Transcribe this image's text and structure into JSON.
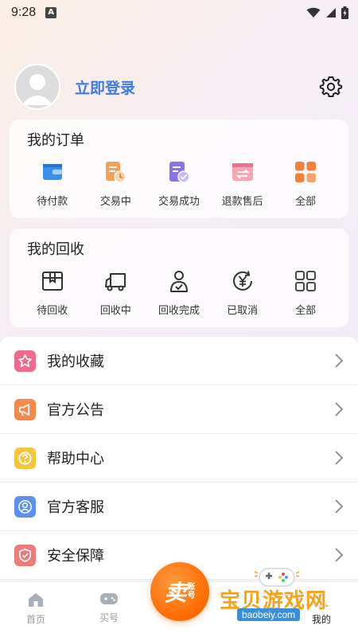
{
  "status_bar": {
    "time": "9:28",
    "notif_letter": "A"
  },
  "profile": {
    "login_label": "立即登录"
  },
  "orders": {
    "title": "我的订单",
    "items": [
      {
        "label": "待付款",
        "icon": "wallet-icon",
        "color": "#3a8fe8"
      },
      {
        "label": "交易中",
        "icon": "trading-clock-icon",
        "color": "#f5a05a"
      },
      {
        "label": "交易成功",
        "icon": "doc-check-icon",
        "color": "#8a72e8"
      },
      {
        "label": "退款售后",
        "icon": "exchange-icon",
        "color": "#f0708e"
      },
      {
        "label": "全部",
        "icon": "grid-icon",
        "color": "#f57f3c"
      }
    ]
  },
  "recycle": {
    "title": "我的回收",
    "items": [
      {
        "label": "待回收",
        "icon": "box-icon"
      },
      {
        "label": "回收中",
        "icon": "truck-icon"
      },
      {
        "label": "回收完成",
        "icon": "user-check-icon"
      },
      {
        "label": "已取消",
        "icon": "yen-refresh-icon"
      },
      {
        "label": "全部",
        "icon": "grid-outline-icon"
      }
    ]
  },
  "menu": [
    {
      "label": "我的收藏",
      "icon": "star-icon",
      "color": "#f06a8a"
    },
    {
      "label": "官方公告",
      "icon": "megaphone-icon",
      "color": "#f5894a"
    },
    {
      "label": "帮助中心",
      "icon": "help-icon",
      "color": "#f5c542"
    },
    {
      "label": "官方客服",
      "icon": "customer-service-icon",
      "color": "#5b8ff0"
    },
    {
      "label": "安全保障",
      "icon": "shield-icon",
      "color": "#f07a7a"
    }
  ],
  "tabbar": {
    "tabs": [
      {
        "label": "首页",
        "icon": "home-icon"
      },
      {
        "label": "买号",
        "icon": "gamepad-icon"
      },
      {
        "label": "我的",
        "icon": "profile-icon"
      }
    ],
    "sell_big": "卖",
    "sell_small_1": "账",
    "sell_small_2": "号"
  },
  "watermark": {
    "title": "宝贝游戏网",
    "url": "baobeiy.com"
  }
}
